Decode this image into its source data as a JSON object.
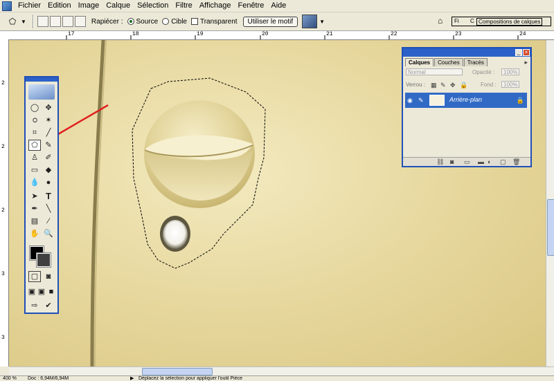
{
  "menu": [
    "Fichier",
    "Edition",
    "Image",
    "Calque",
    "Sélection",
    "Filtre",
    "Affichage",
    "Fenêtre",
    "Aide"
  ],
  "options": {
    "rapiecer_label": "Rapiécer :",
    "source_label": "Source",
    "cible_label": "Cible",
    "transparent_label": "Transparent",
    "motif_button": "Utiliser le motif",
    "comps_tab_fi": "Fi",
    "comps_tab_c": "C",
    "comps_label": "Compositions de calques"
  },
  "ruler_top": [
    "17",
    "18",
    "19",
    "20",
    "21",
    "22",
    "23",
    "24"
  ],
  "ruler_left": [
    "2",
    "2",
    "2",
    "3",
    "3"
  ],
  "layers_panel": {
    "tabs": [
      "Calques",
      "Couches",
      "Tracés"
    ],
    "blend_mode": "Normal",
    "opacity_label": "Opacité :",
    "opacity_value": "100%",
    "lock_label": "Verrou :",
    "fill_label": "Fond :",
    "fill_value": "100%",
    "layer_name": "Arrière-plan"
  },
  "status": {
    "zoom": "400 %",
    "doc": "Doc : 6,94M/6,94M",
    "hint": "Déplacez la sélection pour appliquer l'outil Pièce"
  },
  "colors": {
    "foreground": "#000000",
    "background": "#404040",
    "arrow": "#e02020",
    "selection": "#1c6bd0"
  }
}
